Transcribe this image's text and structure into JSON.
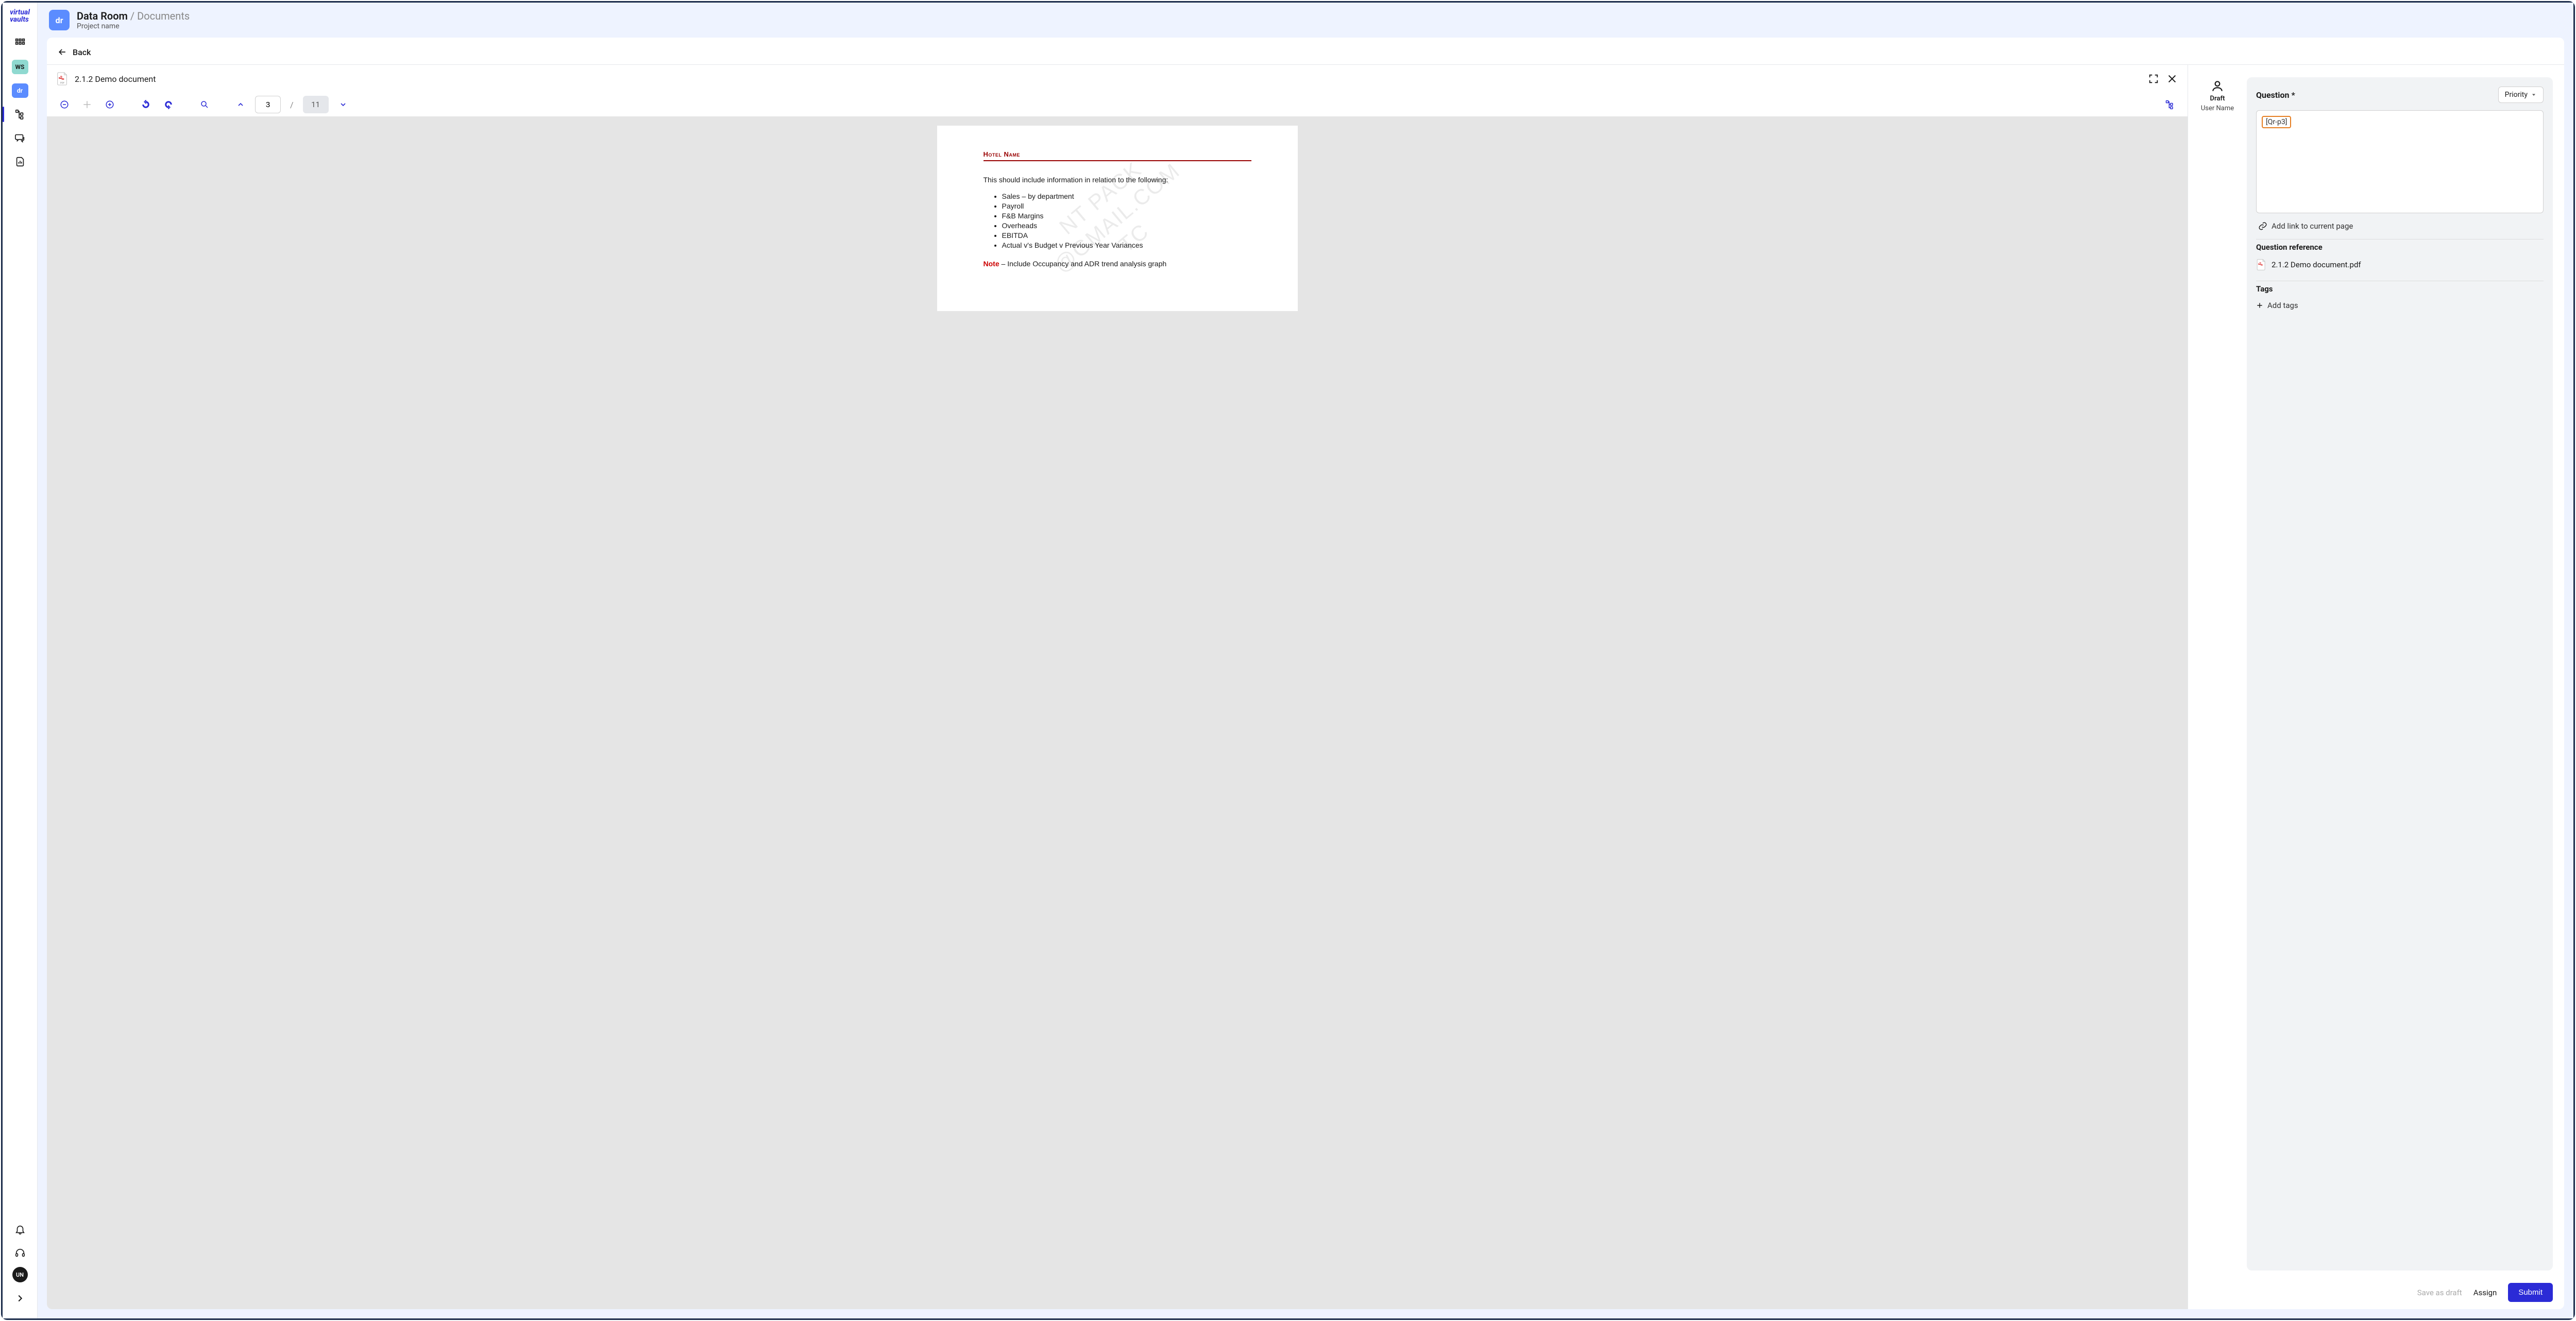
{
  "logo": "virtual\nvaults",
  "sidebar": {
    "ws": "WS",
    "dr": "dr",
    "avatar": "UN"
  },
  "header": {
    "badge": "dr",
    "title_a": "Data Room",
    "title_sep": " / ",
    "title_b": "Documents",
    "subtitle": "Project name"
  },
  "back_label": "Back",
  "document": {
    "title": "2.1.2 Demo document",
    "page_current": "3",
    "page_total": "11",
    "content": {
      "heading": "Hotel Name",
      "intro": "This should include information in relation to the following:",
      "bullets": [
        "Sales – by department",
        "Payroll",
        "F&B Margins",
        "Overheads",
        "EBITDA",
        "Actual v's Budget v Previous Year Variances"
      ],
      "note_label": "Note",
      "note_text": " – Include Occupancy and ADR trend analysis graph",
      "watermark": "NT PACK\n@GMAIL.COM\nTC"
    }
  },
  "user": {
    "status": "Draft",
    "name": "User Name"
  },
  "question": {
    "title": "Question *",
    "priority_label": "Priority",
    "chip": "[Qr-p3]",
    "add_link": "Add link to current page",
    "reference_label": "Question reference",
    "reference_file": "2.1.2 Demo document.pdf",
    "tags_label": "Tags",
    "add_tags": "Add tags"
  },
  "footer": {
    "save_draft": "Save as draft",
    "assign": "Assign",
    "submit": "Submit"
  }
}
